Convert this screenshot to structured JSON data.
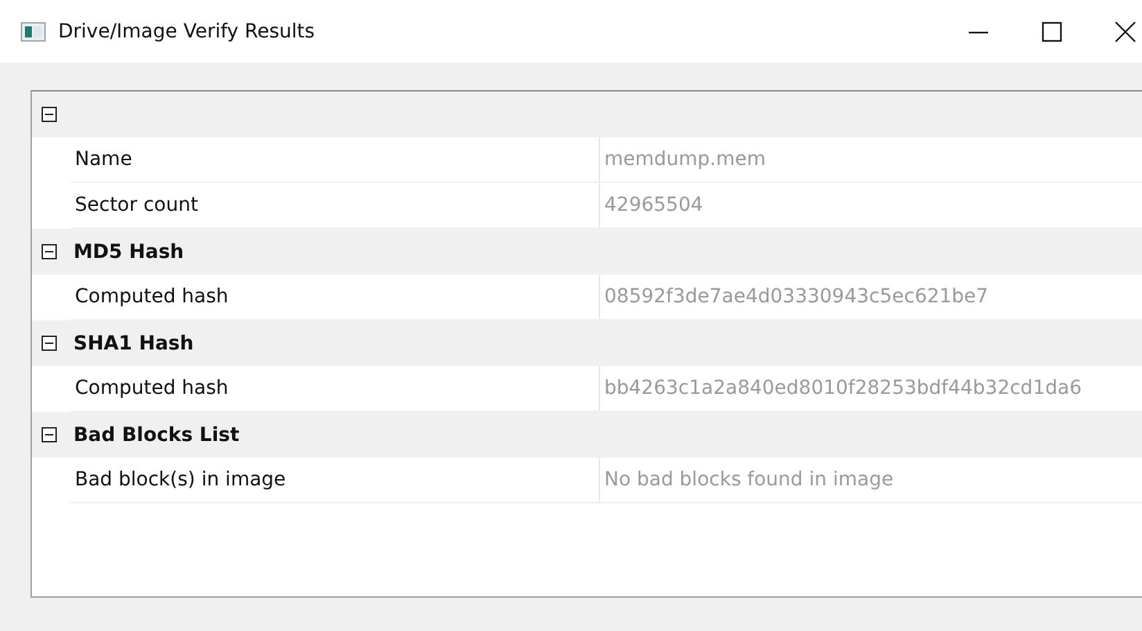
{
  "window": {
    "title": "Drive/Image Verify Results"
  },
  "categories": [
    {
      "expanded": true,
      "properties": [
        {
          "name": "Name",
          "value": "memdump.mem"
        },
        {
          "name": "Sector count",
          "value": "42965504"
        }
      ]
    },
    {
      "label": "MD5 Hash",
      "expanded": true,
      "properties": [
        {
          "name": "Computed hash",
          "value": "08592f3de7ae4d03330943c5ec621be7"
        }
      ]
    },
    {
      "label": "SHA1 Hash",
      "expanded": true,
      "properties": [
        {
          "name": "Computed hash",
          "value": "bb4263c1a2a840ed8010f28253bdf44b32cd1da6"
        }
      ]
    },
    {
      "label": "Bad Blocks List",
      "expanded": true,
      "properties": [
        {
          "name": "Bad block(s) in image",
          "value": "No bad blocks found in image"
        }
      ]
    }
  ]
}
